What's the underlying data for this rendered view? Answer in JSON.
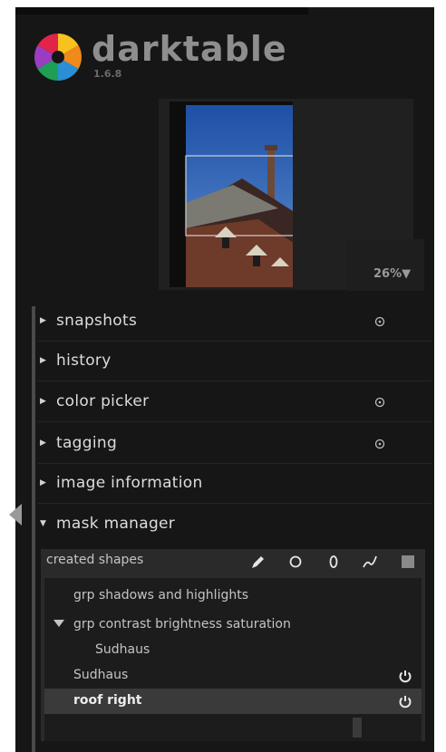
{
  "app": {
    "name": "darktable",
    "version": "1.6.8"
  },
  "navigation": {
    "zoom_label": "26%▼"
  },
  "modules": [
    {
      "label": "snapshots",
      "expanded": false,
      "has_power_button": true
    },
    {
      "label": "history",
      "expanded": false,
      "has_power_button": false
    },
    {
      "label": "color picker",
      "expanded": false,
      "has_power_button": true
    },
    {
      "label": "tagging",
      "expanded": false,
      "has_power_button": true
    },
    {
      "label": "image information",
      "expanded": false,
      "has_power_button": false
    },
    {
      "label": "mask manager",
      "expanded": true,
      "has_power_button": false
    }
  ],
  "mask_manager": {
    "title": "created shapes",
    "tools": [
      "brush-icon",
      "circle-icon",
      "ellipse-icon",
      "path-icon",
      "gradient-icon"
    ],
    "shapes": [
      {
        "label": "grp shadows and highlights",
        "expanded": false,
        "selected": false
      },
      {
        "label": "grp contrast brightness saturation",
        "expanded": true,
        "selected": false
      },
      {
        "label": "Sudhaus",
        "expanded": false,
        "selected": false
      },
      {
        "label": "Sudhaus",
        "expanded": false,
        "selected": false,
        "power": true
      },
      {
        "label": "roof right",
        "expanded": false,
        "selected": true,
        "power": true
      }
    ]
  },
  "colors": {
    "panel_bg": "#161616",
    "text": "#dcdcdc",
    "selected_row": "#3a3a3a"
  }
}
